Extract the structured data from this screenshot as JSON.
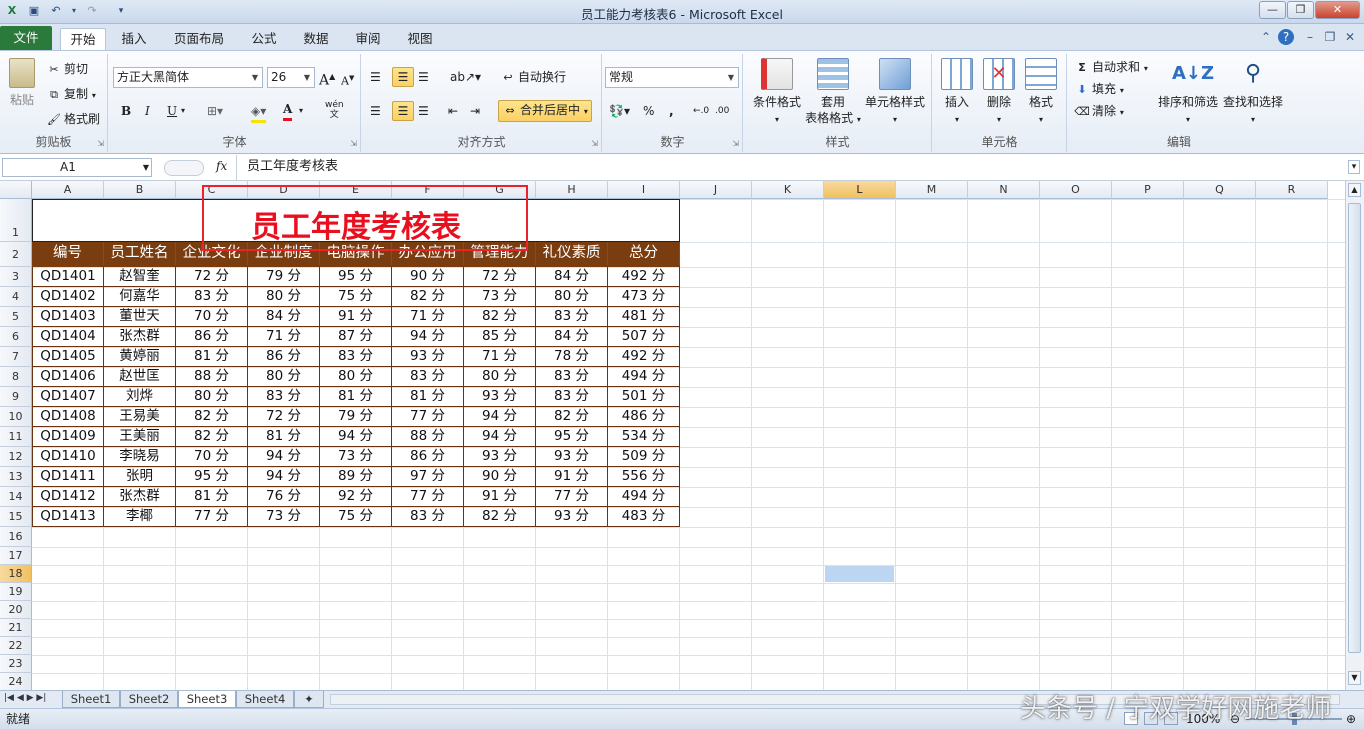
{
  "window": {
    "title": "员工能力考核表6 - Microsoft Excel"
  },
  "ribbon_tabs": [
    "文件",
    "开始",
    "插入",
    "页面布局",
    "公式",
    "数据",
    "审阅",
    "视图"
  ],
  "clipboard": {
    "paste": "粘贴",
    "cut": "剪切",
    "copy": "复制",
    "format_painter": "格式刷",
    "label": "剪贴板"
  },
  "font": {
    "name": "方正大黑简体",
    "size": "26",
    "bold": "B",
    "italic": "I",
    "underline": "U",
    "label": "字体",
    "grow": "A",
    "shrink": "A",
    "color_a": "A",
    "phonetic": "wén"
  },
  "alignment": {
    "wrap": "自动换行",
    "merge": "合并后居中",
    "label": "对齐方式"
  },
  "number": {
    "format": "常规",
    "percent": "%",
    "comma": ",",
    "label": "数字"
  },
  "styles": {
    "conditional": "条件格式",
    "table_1": "套用",
    "table_2": "表格格式",
    "cell_styles": "单元格样式",
    "label": "样式"
  },
  "cells": {
    "insert": "插入",
    "delete": "删除",
    "format": "格式",
    "label": "单元格"
  },
  "editing": {
    "autosum": "自动求和",
    "fill": "填充",
    "clear": "清除",
    "sort": "排序和筛选",
    "find": "查找和选择",
    "label": "编辑"
  },
  "formula_bar": {
    "name_box": "A1",
    "fx": "fx",
    "content": "员工年度考核表"
  },
  "columns": [
    "A",
    "B",
    "C",
    "D",
    "E",
    "F",
    "G",
    "H",
    "I",
    "J",
    "K",
    "L",
    "M",
    "N",
    "O",
    "P",
    "Q",
    "R"
  ],
  "rows": [
    "1",
    "2",
    "3",
    "4",
    "5",
    "6",
    "7",
    "8",
    "9",
    "10",
    "11",
    "12",
    "13",
    "14",
    "15",
    "16",
    "17",
    "18",
    "19",
    "20",
    "21",
    "22",
    "23",
    "24"
  ],
  "table": {
    "title": "员工年度考核表",
    "headers": [
      "编号",
      "员工姓名",
      "企业文化",
      "企业制度",
      "电脑操作",
      "办公应用",
      "管理能力",
      "礼仪素质",
      "总分"
    ],
    "rows": [
      [
        "QD1401",
        "赵智奎",
        "72 分",
        "79 分",
        "95 分",
        "90 分",
        "72 分",
        "84 分",
        "492 分"
      ],
      [
        "QD1402",
        "何嘉华",
        "83 分",
        "80 分",
        "75 分",
        "82 分",
        "73 分",
        "80 分",
        "473 分"
      ],
      [
        "QD1403",
        "董世天",
        "70 分",
        "84 分",
        "91 分",
        "71 分",
        "82 分",
        "83 分",
        "481 分"
      ],
      [
        "QD1404",
        "张杰群",
        "86 分",
        "71 分",
        "87 分",
        "94 分",
        "85 分",
        "84 分",
        "507 分"
      ],
      [
        "QD1405",
        "黄婷丽",
        "81 分",
        "86 分",
        "83 分",
        "93 分",
        "71 分",
        "78 分",
        "492 分"
      ],
      [
        "QD1406",
        "赵世匡",
        "88 分",
        "80 分",
        "80 分",
        "83 分",
        "80 分",
        "83 分",
        "494 分"
      ],
      [
        "QD1407",
        "刘烨",
        "80 分",
        "83 分",
        "81 分",
        "81 分",
        "93 分",
        "83 分",
        "501 分"
      ],
      [
        "QD1408",
        "王易美",
        "82 分",
        "72 分",
        "79 分",
        "77 分",
        "94 分",
        "82 分",
        "486 分"
      ],
      [
        "QD1409",
        "王美丽",
        "82 分",
        "81 分",
        "94 分",
        "88 分",
        "94 分",
        "95 分",
        "534 分"
      ],
      [
        "QD1410",
        "李晓易",
        "70 分",
        "94 分",
        "73 分",
        "86 分",
        "93 分",
        "93 分",
        "509 分"
      ],
      [
        "QD1411",
        "张明",
        "95 分",
        "94 分",
        "89 分",
        "97 分",
        "90 分",
        "91 分",
        "556 分"
      ],
      [
        "QD1412",
        "张杰群",
        "81 分",
        "76 分",
        "92 分",
        "77 分",
        "91 分",
        "77 分",
        "494 分"
      ],
      [
        "QD1413",
        "李椰",
        "77 分",
        "73 分",
        "75 分",
        "83 分",
        "82 分",
        "93 分",
        "483 分"
      ]
    ]
  },
  "sheets": [
    "Sheet1",
    "Sheet2",
    "Sheet3",
    "Sheet4"
  ],
  "active_sheet": "Sheet3",
  "status": {
    "ready": "就绪",
    "zoom": "100%"
  },
  "watermark": "头条号 / 宁双学好网施老师",
  "colors": {
    "header_fill": "#7a3d10",
    "title_color": "#e8101f",
    "annotation_box": "#e8232b",
    "file_tab": "#2a7a3b",
    "selection": "#bcd6f2"
  }
}
